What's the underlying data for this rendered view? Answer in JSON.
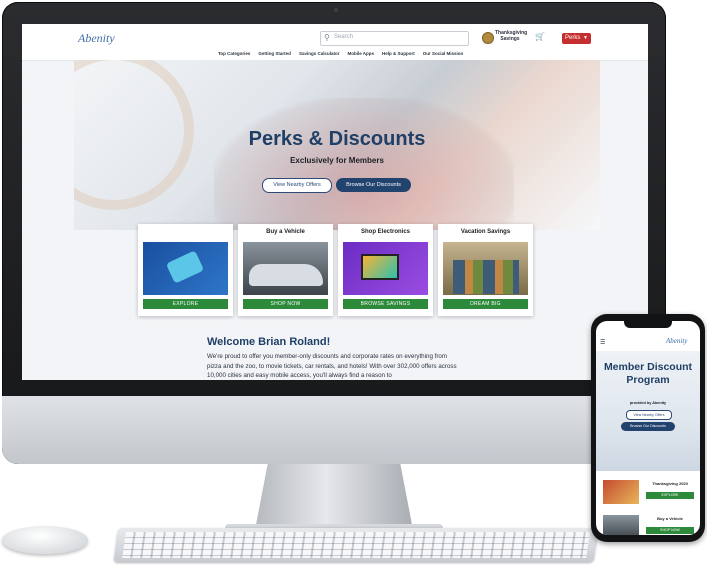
{
  "site": {
    "logo": "Abenity",
    "search_placeholder": "Search",
    "promo": "Thanksgiving Savings",
    "perks_label": "Perks",
    "nav": [
      "Top Categories",
      "Getting Started",
      "Savings Calculator",
      "Mobile Apps",
      "Help & Support",
      "Our Social Mission"
    ]
  },
  "hero": {
    "title": "Perks & Discounts",
    "subtitle": "Exclusively for Members",
    "btn_nearby": "View Nearby Offers",
    "btn_browse": "Browse Our Discounts"
  },
  "cards": [
    {
      "title": "",
      "button": "EXPLORE"
    },
    {
      "title": "Buy a Vehicle",
      "button": "SHOP NOW"
    },
    {
      "title": "Shop Electronics",
      "button": "BROWSE SAVINGS"
    },
    {
      "title": "Vacation Savings",
      "button": "DREAM BIG"
    }
  ],
  "welcome": {
    "heading": "Welcome Brian Roland!",
    "body": "We're proud to offer you member-only discounts and corporate rates on everything from pizza and the zoo, to movie tickets, car rentals, and hotels! With over 302,000 offers across 10,000 cities and easy mobile access, you'll always find a reason to"
  },
  "phone": {
    "logo": "Abenity",
    "title": "Member Discount Program",
    "subtitle": "provided by Abenity",
    "btn_nearby": "View Nearby Offers",
    "btn_browse": "Browse Our Discounts",
    "card1_title": "Thanksgiving 2020",
    "card1_button": "EXPLORE",
    "card2_title": "Buy a Vehicle",
    "card2_button": "SHOP NOW"
  },
  "colors": {
    "brand_navy": "#1f3f66",
    "cta_green": "#2d8a3a",
    "perks_red": "#c62f2f"
  },
  "icons": [
    "search-icon",
    "cart-icon",
    "chevron-down-icon",
    "hamburger-menu-icon",
    "turkey-badge-icon"
  ]
}
